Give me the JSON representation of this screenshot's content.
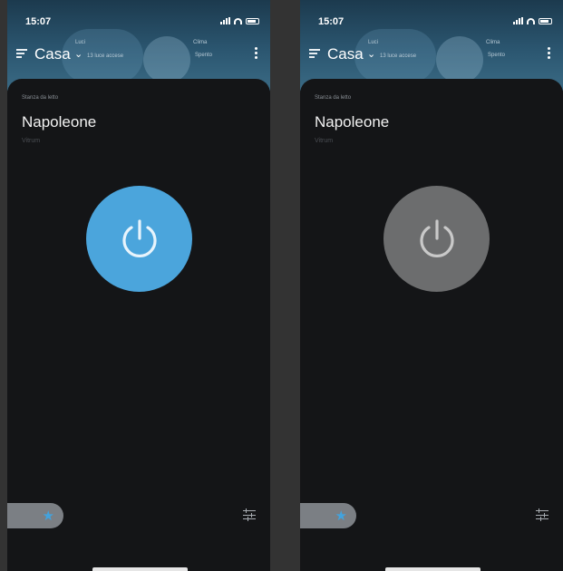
{
  "screens": [
    {
      "id": "on",
      "status": {
        "time": "15:07"
      },
      "header": {
        "home_title": "Casa",
        "chip_lights_label": "Luci",
        "chip_lights_sub": "13 luce accese",
        "chip_climate_label": "Clima",
        "chip_climate_sub": "Spento"
      },
      "device": {
        "room": "Stanza da letto",
        "name": "Napoleone",
        "model": "Vitrum",
        "power_state": "on",
        "power_color": "#4ba5dc"
      },
      "footer": {
        "favorite_icon": "star-icon",
        "settings_icon": "tune-icon"
      }
    },
    {
      "id": "off",
      "status": {
        "time": "15:07"
      },
      "header": {
        "home_title": "Casa",
        "chip_lights_label": "Luci",
        "chip_lights_sub": "13 luce accese",
        "chip_climate_label": "Clima",
        "chip_climate_sub": "Spento"
      },
      "device": {
        "room": "Stanza da letto",
        "name": "Napoleone",
        "model": "Vitrum",
        "power_state": "off",
        "power_color": "#6c6d6e"
      },
      "footer": {
        "favorite_icon": "star-icon",
        "settings_icon": "tune-icon"
      }
    }
  ],
  "colors": {
    "accent": "#4ba5dc",
    "sheet": "#141517",
    "header": "#2b5670"
  }
}
